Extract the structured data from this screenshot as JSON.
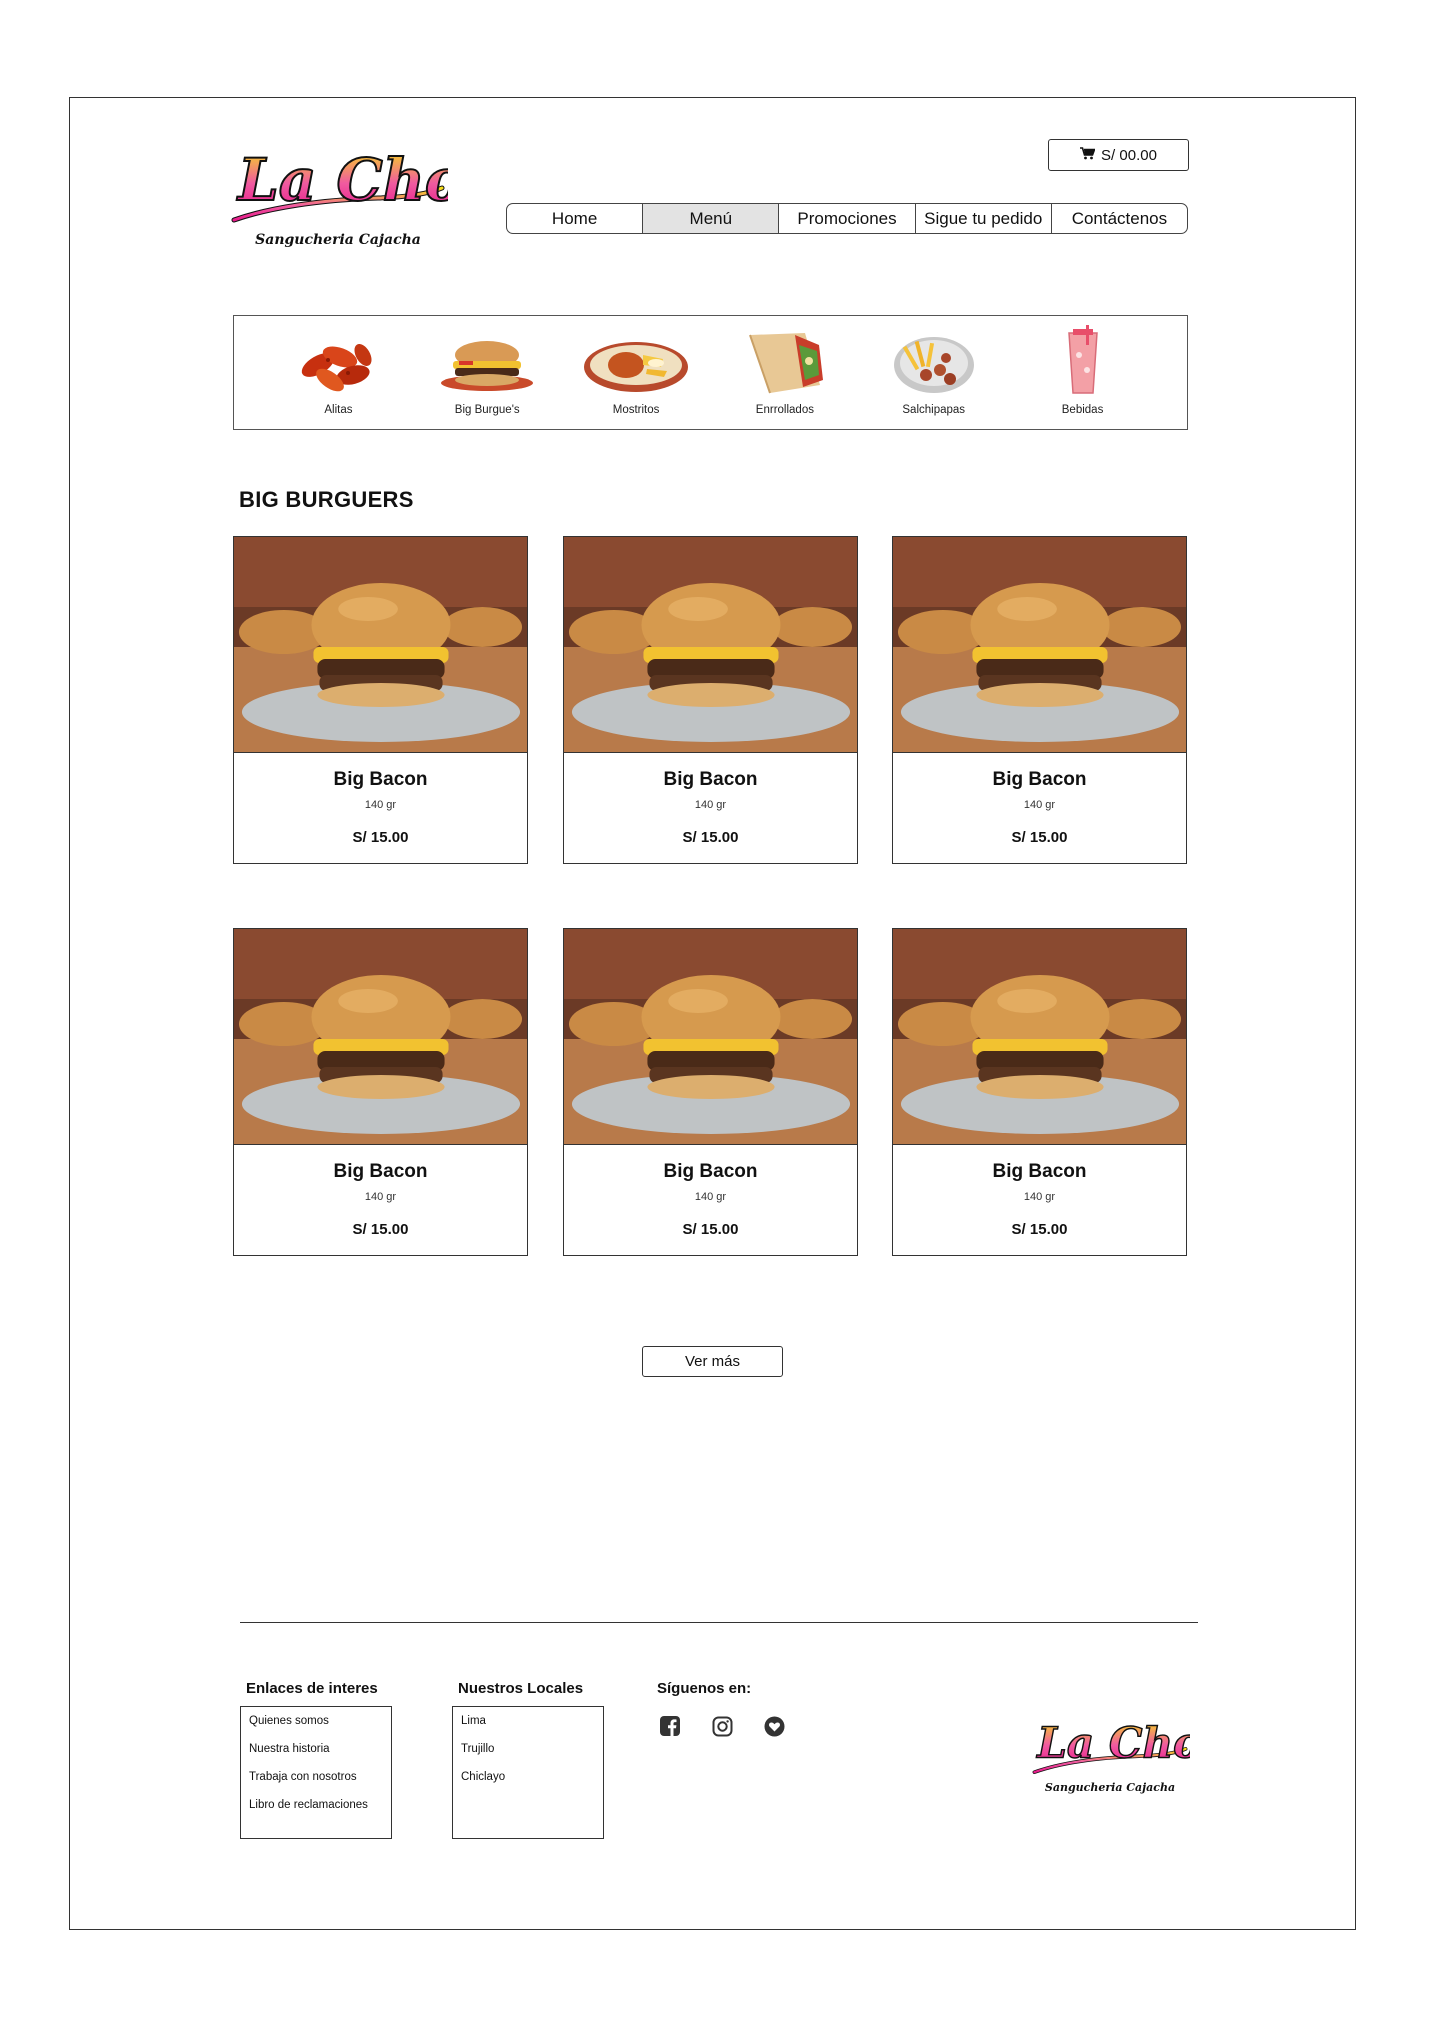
{
  "brand": {
    "name": "La Chola",
    "tagline": "Sangucheria Cajacha"
  },
  "cart": {
    "icon": "cart-icon",
    "total": "S/ 00.00"
  },
  "nav": {
    "items": [
      "Home",
      "Menú",
      "Promociones",
      "Sigue tu pedido",
      "Contáctenos"
    ],
    "active": "Menú"
  },
  "categories": [
    {
      "label": "Alitas",
      "icon": "wings-icon"
    },
    {
      "label": "Big Burgue's",
      "icon": "burger-icon"
    },
    {
      "label": "Mostritos",
      "icon": "mostrito-icon"
    },
    {
      "label": "Enrrollados",
      "icon": "wrap-icon"
    },
    {
      "label": "Salchipapas",
      "icon": "salchipapa-icon"
    },
    {
      "label": "Bebidas",
      "icon": "drink-icon"
    }
  ],
  "section": {
    "title": "BIG BURGUERS"
  },
  "products": [
    {
      "name": "Big Bacon",
      "weight": "140 gr",
      "price": "S/ 15.00"
    },
    {
      "name": "Big Bacon",
      "weight": "140 gr",
      "price": "S/ 15.00"
    },
    {
      "name": "Big Bacon",
      "weight": "140 gr",
      "price": "S/ 15.00"
    },
    {
      "name": "Big Bacon",
      "weight": "140 gr",
      "price": "S/ 15.00"
    },
    {
      "name": "Big Bacon",
      "weight": "140 gr",
      "price": "S/ 15.00"
    },
    {
      "name": "Big Bacon",
      "weight": "140 gr",
      "price": "S/ 15.00"
    }
  ],
  "more_button": "Ver más",
  "footer": {
    "links_heading": "Enlaces de interes",
    "links": [
      "Quienes somos",
      "Nuestra historia",
      "Trabaja con nosotros",
      "Libro de reclamaciones"
    ],
    "locales_heading": "Nuestros Locales",
    "locales": [
      "Lima",
      "Trujillo",
      "Chiclayo"
    ],
    "social_heading": "Síguenos en:",
    "social": [
      "facebook-icon",
      "instagram-icon",
      "heart-icon"
    ]
  },
  "colors": {
    "logo_pink": "#e8198b",
    "logo_yellow": "#f7e017",
    "active_nav": "#e3e3e3",
    "border": "#333333"
  }
}
